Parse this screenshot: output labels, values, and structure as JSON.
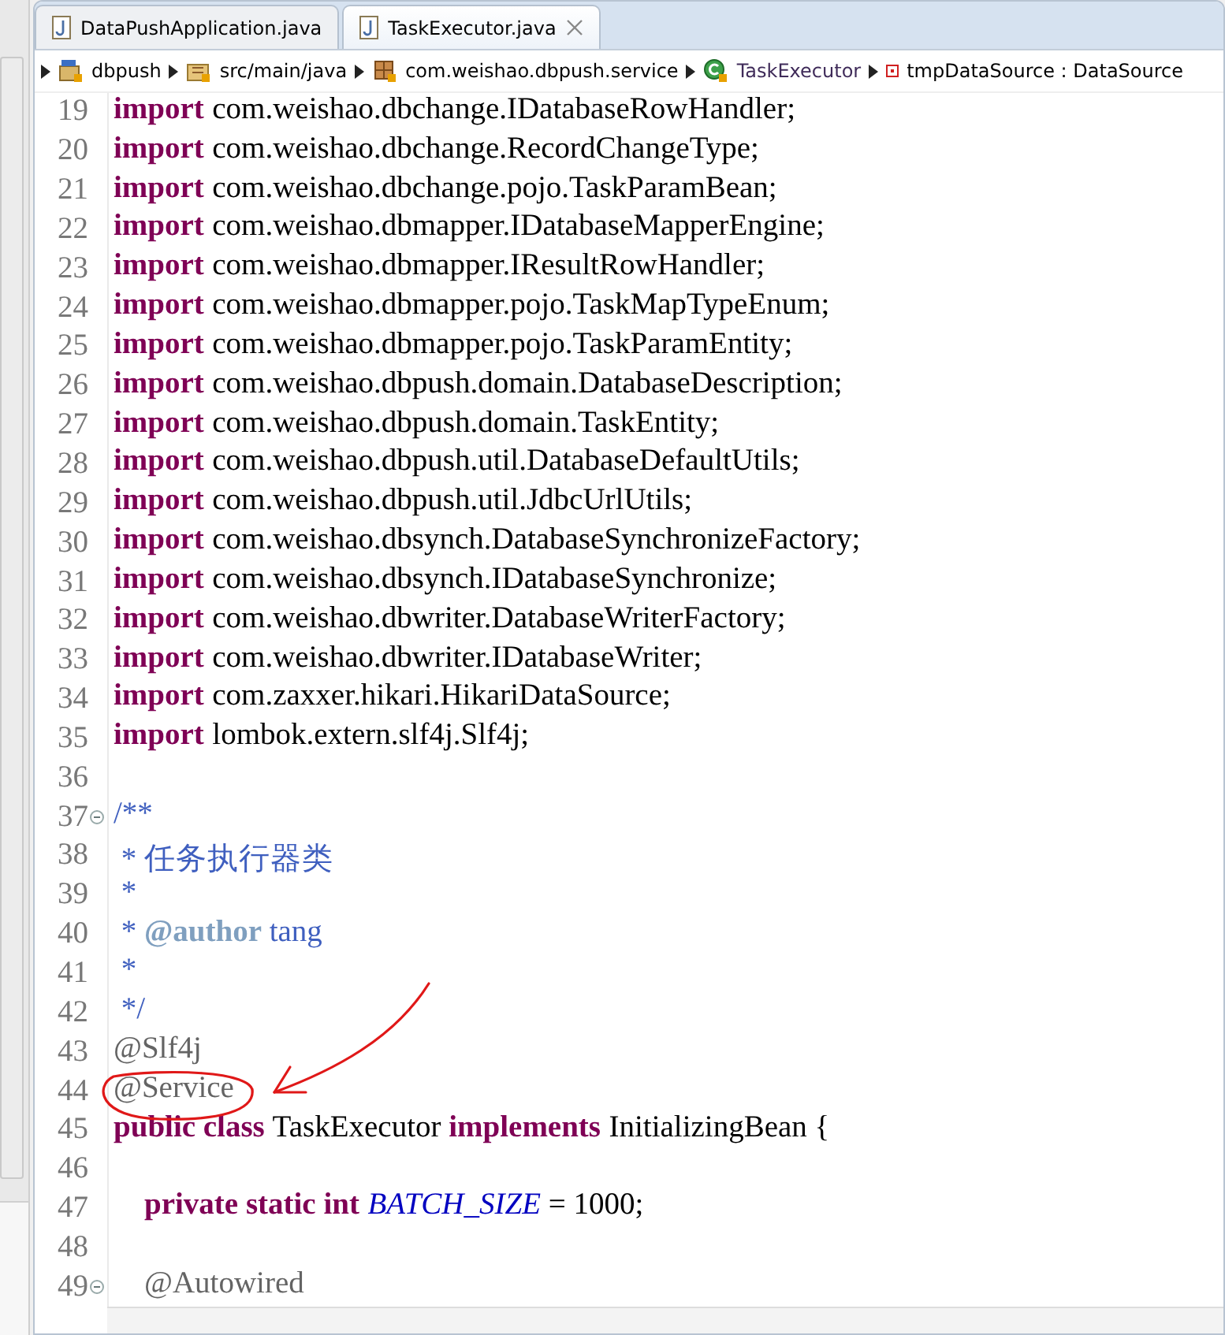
{
  "tabs": [
    {
      "label": "DataPushApplication.java",
      "selected": false
    },
    {
      "label": "TaskExecutor.java",
      "selected": true
    }
  ],
  "breadcrumb": [
    {
      "kind": "project",
      "label": "dbpush"
    },
    {
      "kind": "folder",
      "label": "src/main/java"
    },
    {
      "kind": "package",
      "label": "com.weishao.dbpush.service"
    },
    {
      "kind": "class",
      "label": "TaskExecutor"
    },
    {
      "kind": "field",
      "label": "tmpDataSource : DataSource"
    }
  ],
  "lines": [
    {
      "number": "19",
      "folding": false,
      "tokens": [
        {
          "kind": "keyword",
          "text": "import"
        },
        {
          "kind": "plain",
          "text": " com.weishao.dbchange.IDatabaseRowHandler;"
        }
      ]
    },
    {
      "number": "20",
      "folding": false,
      "tokens": [
        {
          "kind": "keyword",
          "text": "import"
        },
        {
          "kind": "plain",
          "text": " com.weishao.dbchange.RecordChangeType;"
        }
      ]
    },
    {
      "number": "21",
      "folding": false,
      "tokens": [
        {
          "kind": "keyword",
          "text": "import"
        },
        {
          "kind": "plain",
          "text": " com.weishao.dbchange.pojo.TaskParamBean;"
        }
      ]
    },
    {
      "number": "22",
      "folding": false,
      "tokens": [
        {
          "kind": "keyword",
          "text": "import"
        },
        {
          "kind": "plain",
          "text": " com.weishao.dbmapper.IDatabaseMapperEngine;"
        }
      ]
    },
    {
      "number": "23",
      "folding": false,
      "tokens": [
        {
          "kind": "keyword",
          "text": "import"
        },
        {
          "kind": "plain",
          "text": " com.weishao.dbmapper.IResultRowHandler;"
        }
      ]
    },
    {
      "number": "24",
      "folding": false,
      "tokens": [
        {
          "kind": "keyword",
          "text": "import"
        },
        {
          "kind": "plain",
          "text": " com.weishao.dbmapper.pojo.TaskMapTypeEnum;"
        }
      ]
    },
    {
      "number": "25",
      "folding": false,
      "tokens": [
        {
          "kind": "keyword",
          "text": "import"
        },
        {
          "kind": "plain",
          "text": " com.weishao.dbmapper.pojo.TaskParamEntity;"
        }
      ]
    },
    {
      "number": "26",
      "folding": false,
      "tokens": [
        {
          "kind": "keyword",
          "text": "import"
        },
        {
          "kind": "plain",
          "text": " com.weishao.dbpush.domain.DatabaseDescription;"
        }
      ]
    },
    {
      "number": "27",
      "folding": false,
      "tokens": [
        {
          "kind": "keyword",
          "text": "import"
        },
        {
          "kind": "plain",
          "text": " com.weishao.dbpush.domain.TaskEntity;"
        }
      ]
    },
    {
      "number": "28",
      "folding": false,
      "tokens": [
        {
          "kind": "keyword",
          "text": "import"
        },
        {
          "kind": "plain",
          "text": " com.weishao.dbpush.util.DatabaseDefaultUtils;"
        }
      ]
    },
    {
      "number": "29",
      "folding": false,
      "tokens": [
        {
          "kind": "keyword",
          "text": "import"
        },
        {
          "kind": "plain",
          "text": " com.weishao.dbpush.util.JdbcUrlUtils;"
        }
      ]
    },
    {
      "number": "30",
      "folding": false,
      "tokens": [
        {
          "kind": "keyword",
          "text": "import"
        },
        {
          "kind": "plain",
          "text": " com.weishao.dbsynch.DatabaseSynchronizeFactory;"
        }
      ]
    },
    {
      "number": "31",
      "folding": false,
      "tokens": [
        {
          "kind": "keyword",
          "text": "import"
        },
        {
          "kind": "plain",
          "text": " com.weishao.dbsynch.IDatabaseSynchronize;"
        }
      ]
    },
    {
      "number": "32",
      "folding": false,
      "tokens": [
        {
          "kind": "keyword",
          "text": "import"
        },
        {
          "kind": "plain",
          "text": " com.weishao.dbwriter.DatabaseWriterFactory;"
        }
      ]
    },
    {
      "number": "33",
      "folding": false,
      "tokens": [
        {
          "kind": "keyword",
          "text": "import"
        },
        {
          "kind": "plain",
          "text": " com.weishao.dbwriter.IDatabaseWriter;"
        }
      ]
    },
    {
      "number": "34",
      "folding": false,
      "tokens": [
        {
          "kind": "keyword",
          "text": "import"
        },
        {
          "kind": "plain",
          "text": " com.zaxxer.hikari.HikariDataSource;"
        }
      ]
    },
    {
      "number": "35",
      "folding": false,
      "tokens": [
        {
          "kind": "keyword",
          "text": "import"
        },
        {
          "kind": "plain",
          "text": " lombok.extern.slf4j.Slf4j;"
        }
      ]
    },
    {
      "number": "36",
      "folding": false
    },
    {
      "number": "37",
      "folding": true,
      "tokens": [
        {
          "kind": "javadoc",
          "text": "/**"
        }
      ]
    },
    {
      "number": "38",
      "folding": false,
      "tokens": [
        {
          "kind": "javadoc",
          "text": " * 任务执行器类"
        }
      ]
    },
    {
      "number": "39",
      "folding": false,
      "tokens": [
        {
          "kind": "javadoc",
          "text": " *"
        }
      ]
    },
    {
      "number": "40",
      "folding": false,
      "tokens": [
        {
          "kind": "javadoc",
          "text": " * "
        },
        {
          "kind": "doctag",
          "text": "@author"
        },
        {
          "kind": "javadoc",
          "text": " tang"
        }
      ]
    },
    {
      "number": "41",
      "folding": false,
      "tokens": [
        {
          "kind": "javadoc",
          "text": " *"
        }
      ]
    },
    {
      "number": "42",
      "folding": false,
      "tokens": [
        {
          "kind": "javadoc",
          "text": " */"
        }
      ]
    },
    {
      "number": "43",
      "folding": false,
      "tokens": [
        {
          "kind": "annotation",
          "text": "@Slf4j"
        }
      ]
    },
    {
      "number": "44",
      "folding": false,
      "tokens": [
        {
          "kind": "annotation",
          "text": "@Service"
        }
      ]
    },
    {
      "number": "45",
      "folding": false,
      "tokens": [
        {
          "kind": "keyword",
          "text": "public class"
        },
        {
          "kind": "plain",
          "text": " TaskExecutor "
        },
        {
          "kind": "keyword",
          "text": "implements"
        },
        {
          "kind": "plain",
          "text": " InitializingBean {"
        }
      ]
    },
    {
      "number": "46",
      "folding": false
    },
    {
      "number": "47",
      "folding": false,
      "tokens": [
        {
          "kind": "keyword",
          "text": "    private static int"
        },
        {
          "kind": "constant",
          "text": "BATCH_SIZE"
        },
        {
          "kind": "plain",
          "text": " = 1000;"
        }
      ]
    },
    {
      "number": "48",
      "folding": false
    },
    {
      "number": "49",
      "folding": true,
      "tokens": [
        {
          "kind": "annotation",
          "text": "    @Autowired"
        }
      ]
    }
  ]
}
